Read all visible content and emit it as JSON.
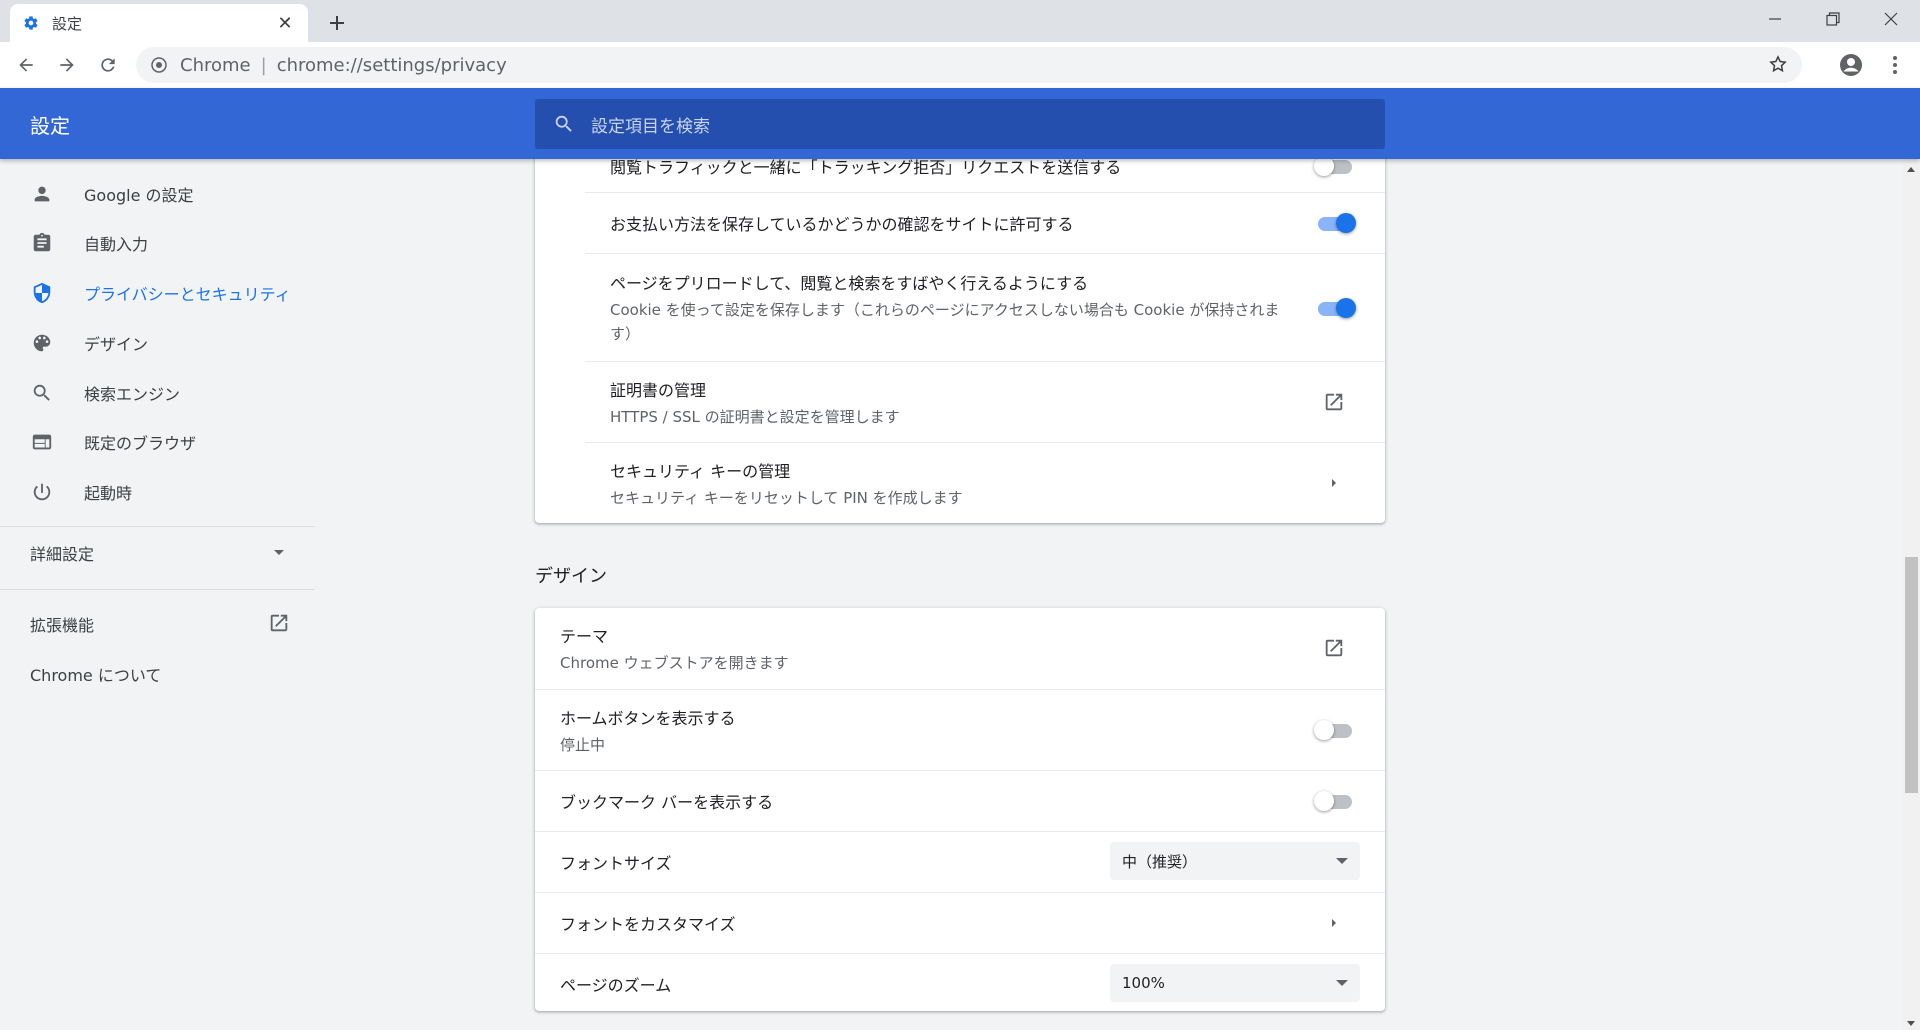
{
  "browser": {
    "tab_title": "設定",
    "tab_close": "✕",
    "new_tab": "+",
    "omnibox_scheme": "Chrome",
    "omnibox_separator": "|",
    "omnibox_url": "chrome://settings/privacy"
  },
  "header": {
    "title": "設定",
    "search_placeholder": "設定項目を検索"
  },
  "sidebar": {
    "items": [
      {
        "label": "Google の設定",
        "icon": "person-icon"
      },
      {
        "label": "自動入力",
        "icon": "clipboard-icon"
      },
      {
        "label": "プライバシーとセキュリティ",
        "icon": "shield-icon",
        "active": true
      },
      {
        "label": "デザイン",
        "icon": "palette-icon"
      },
      {
        "label": "検索エンジン",
        "icon": "search-icon"
      },
      {
        "label": "既定のブラウザ",
        "icon": "browser-icon"
      },
      {
        "label": "起動時",
        "icon": "power-icon"
      }
    ],
    "advanced": "詳細設定",
    "extensions": "拡張機能",
    "about": "Chrome について"
  },
  "privacy_card": {
    "rows": [
      {
        "title": "閲覧トラフィックと一緒に「トラッキング拒否」リクエストを送信する",
        "toggle": false
      },
      {
        "title": "お支払い方法を保存しているかどうかの確認をサイトに許可する",
        "toggle": true
      },
      {
        "title": "ページをプリロードして、閲覧と検索をすばやく行えるようにする",
        "subtitle": "Cookie を使って設定を保存します（これらのページにアクセスしない場合も Cookie が保持されます）",
        "toggle": true
      },
      {
        "title": "証明書の管理",
        "subtitle": "HTTPS / SSL の証明書と設定を管理します",
        "action": "open-in-new-icon"
      },
      {
        "title": "セキュリティ キーの管理",
        "subtitle": "セキュリティ キーをリセットして PIN を作成します",
        "action": "chevron-right-icon"
      }
    ]
  },
  "design": {
    "section_title": "デザイン",
    "rows": [
      {
        "title": "テーマ",
        "subtitle": "Chrome ウェブストアを開きます",
        "action": "open-in-new-icon"
      },
      {
        "title": "ホームボタンを表示する",
        "subtitle": "停止中",
        "toggle": false
      },
      {
        "title": "ブックマーク バーを表示する",
        "toggle": false
      },
      {
        "title": "フォントサイズ",
        "select_value": "中（推奨）"
      },
      {
        "title": "フォントをカスタマイズ",
        "action": "chevron-right-icon"
      },
      {
        "title": "ページのズーム",
        "select_value": "100%"
      }
    ]
  },
  "colors": {
    "header_blue": "#3367d6",
    "accent": "#1a73e8"
  }
}
